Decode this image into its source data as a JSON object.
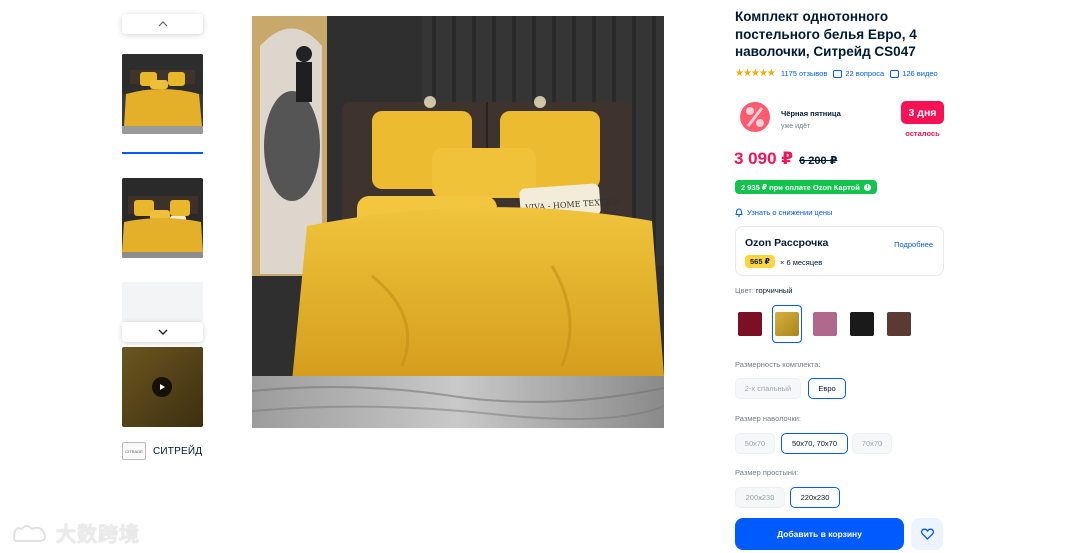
{
  "gallery": {
    "nav_up_icon": "chevron-up-icon",
    "nav_down_icon": "chevron-down-icon",
    "play_icon": "play-icon",
    "brand_name": "СИТРЕЙД",
    "brand_logo_text": "CITRADE"
  },
  "product": {
    "title": "Комплект однотонного постельного белья Евро, 4 наволочки, Ситрейд CS047",
    "pillow_text": "VIVA - HOME TEXTILE",
    "reviews": "1175 отзывов",
    "questions": "22 вопроса",
    "videos": "126 видео"
  },
  "promo": {
    "title": "Чёрная пятница",
    "subtitle": "уже идёт",
    "days": "3 дня",
    "days_left": "осталось",
    "badge_icon": "percent-icon"
  },
  "price": {
    "current": "3 090 ₽",
    "old": "6 200 ₽",
    "card": "2 935 ₽ при оплате Ozon Картой",
    "notify": "Узнать о снижении цены"
  },
  "installment": {
    "title": "Ozon Рассрочка",
    "more": "Подробнее",
    "amount": "565 ₽",
    "months": "× 6 месяцев"
  },
  "color": {
    "label": "Цвет:",
    "value": "горчичный",
    "swatches": [
      "#7a1024",
      "#c9a233",
      "#b0698c",
      "#1a1a1a",
      "#5a3a32"
    ]
  },
  "size": {
    "label": "Размерность комплекта:",
    "options": [
      "2-х спальный",
      "Евро"
    ]
  },
  "pillowcase": {
    "label": "Размер наволочки:",
    "options": [
      "50x70",
      "50x70, 70x70",
      "70x70"
    ]
  },
  "sheet": {
    "label": "Размер простыни:",
    "options": [
      "200x230",
      "220x230"
    ]
  },
  "actions": {
    "add_to_cart": "Добавить в корзину",
    "favorite_icon": "heart-icon"
  },
  "watermark": "大数跨境",
  "colors": {
    "accent": "#005bff",
    "sale": "#f91155",
    "green": "#10c44c",
    "yellow_bedding": "#e8b72a"
  }
}
